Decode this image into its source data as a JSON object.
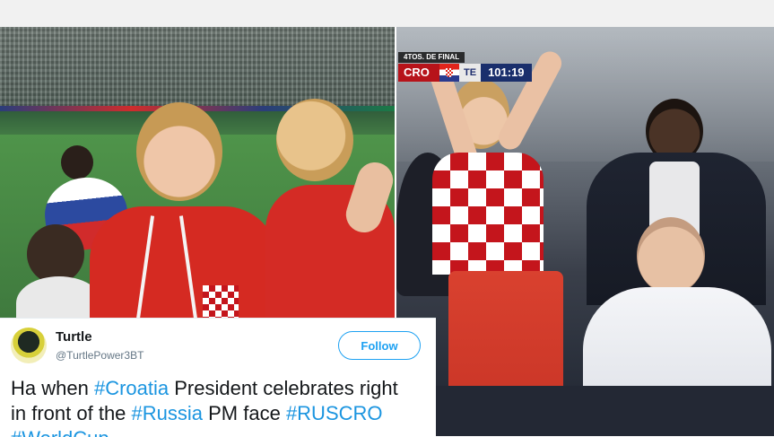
{
  "scoreboard": {
    "stage": "4TOS. DE FINAL",
    "home": "CRO",
    "away": "TE",
    "clock": "101:19"
  },
  "tweet": {
    "name": "Turtle",
    "handle": "@TurtlePower3BT",
    "follow_label": "Follow",
    "text_line1_pre": "Ha when ",
    "text_tag1": "#Croatia",
    "text_line1_post": " President celebrates right",
    "text_line2_pre": "in front of the ",
    "text_tag2": "#Russia",
    "text_line2_mid": " PM face ",
    "text_tag3": "#RUSCRO",
    "text_tag4": "#WorldCup"
  },
  "icons": {
    "avatar": "turtle-avatar-icon",
    "flag": "croatia-flag-icon"
  },
  "colors": {
    "link": "#1b95e0",
    "follow": "#1da1f2",
    "cro_red": "#b7131a",
    "clock_blue": "#1a2f6c"
  }
}
